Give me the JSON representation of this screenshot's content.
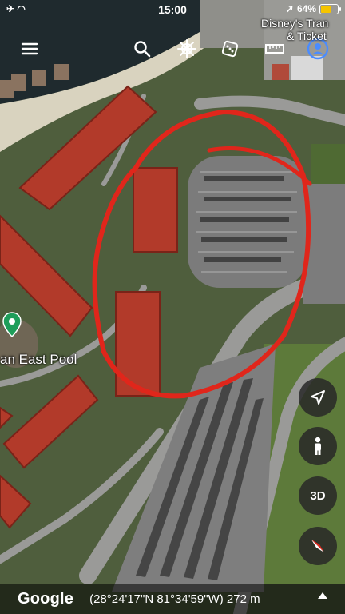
{
  "status_bar": {
    "time": "15:00",
    "battery_percent": "64%",
    "battery_level": 0.64
  },
  "map": {
    "labels": {
      "pool": "an East Pool",
      "poi_line1": "Disney's Tran",
      "poi_line2": "& Ticket"
    },
    "annotation_color": "#e0261b"
  },
  "bottom_bar": {
    "logo": "Google",
    "coordinates": "(28°24'17\"N 81°34'59\"W) 272 m"
  },
  "controls": {
    "three_d": "3D"
  },
  "icons": {
    "menu": "menu-icon",
    "search": "search-icon",
    "voyager": "ship-wheel-icon",
    "feeling_lucky": "dice-icon",
    "measure": "ruler-icon",
    "my_places": "user-circle-icon",
    "location": "navigation-arrow-icon",
    "street_view": "pegman-icon",
    "compass": "compass-icon"
  }
}
